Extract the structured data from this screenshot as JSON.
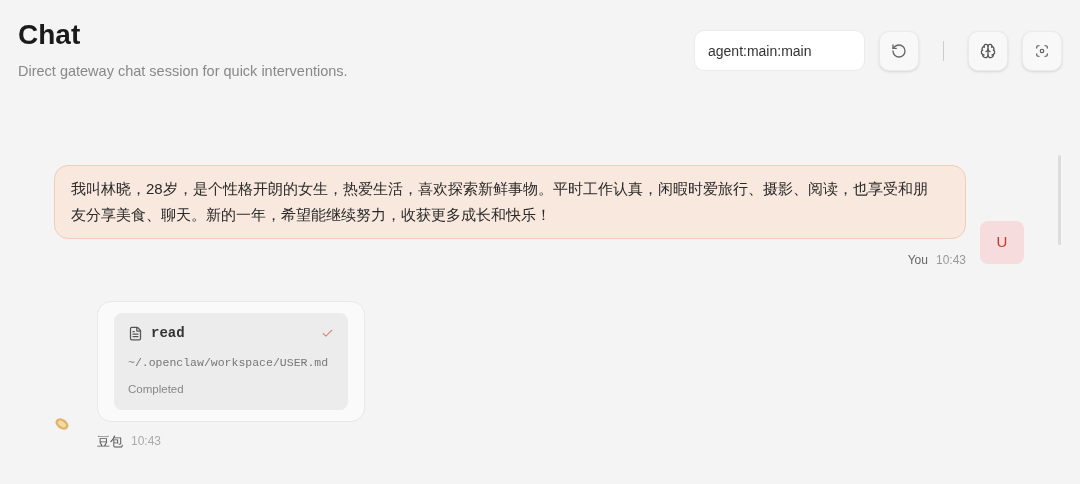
{
  "header": {
    "title": "Chat",
    "subtitle": "Direct gateway chat session for quick interventions."
  },
  "session_field": {
    "value": "agent:main:main"
  },
  "messages": [
    {
      "kind": "user",
      "text": "我叫林晓，28岁，是个性格开朗的女生，热爱生活，喜欢探索新鲜事物。平时工作认真，闲暇时爱旅行、摄影、阅读，也享受和朋友分享美食、聊天。新的一年，希望能继续努力，收获更多成长和快乐！",
      "avatar": "U",
      "sender": "You",
      "time": "10:43"
    },
    {
      "kind": "tool",
      "tool": {
        "name": "read",
        "path": "~/.openclaw/workspace/USER.md",
        "status": "Completed",
        "done": true
      },
      "sender": "豆包",
      "time": "10:43"
    }
  ]
}
